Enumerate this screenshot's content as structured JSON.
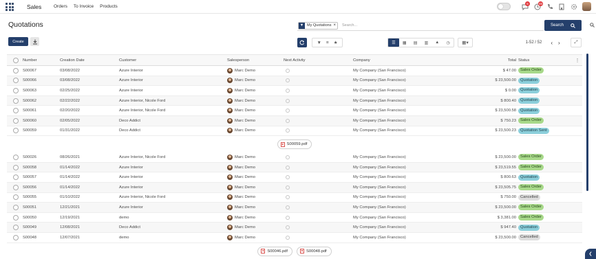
{
  "app": {
    "brand": "Sales",
    "menu": [
      "Orders",
      "To Invoice",
      "Products"
    ],
    "badges": {
      "chat": "6",
      "activity": "46"
    }
  },
  "page": {
    "title": "Quotations",
    "create_label": "Create"
  },
  "search": {
    "facet": "My Quotations",
    "placeholder": "Search...",
    "button_label": "Search"
  },
  "pager": {
    "range": "1-52 / 52"
  },
  "columns": {
    "number": "Number",
    "date": "Creation Date",
    "customer": "Customer",
    "salesperson": "Salesperson",
    "activity": "Next Activity",
    "company": "Company",
    "total": "Total",
    "status": "Status"
  },
  "rows_a": [
    {
      "num": "S00067",
      "date": "03/08/2022",
      "customer": "Azure Interior",
      "sales": "Marc Demo",
      "company": "My Company (San Francisco)",
      "total": "$ 47.00",
      "status": "Sales Order",
      "st": "so"
    },
    {
      "num": "S00066",
      "date": "03/08/2022",
      "customer": "Azure Interior",
      "sales": "Marc Demo",
      "company": "My Company (San Francisco)",
      "total": "$ 23,500.00",
      "status": "Quotation",
      "st": "q"
    },
    {
      "num": "S00063",
      "date": "02/25/2022",
      "customer": "Azure Interior",
      "sales": "Marc Demo",
      "company": "My Company (San Francisco)",
      "total": "$ 0.00",
      "status": "Quotation",
      "st": "q"
    },
    {
      "num": "S00062",
      "date": "02/22/2022",
      "customer": "Azure Interior, Nicole Ford",
      "sales": "Marc Demo",
      "company": "My Company (San Francisco)",
      "total": "$ 800.40",
      "status": "Quotation",
      "st": "q"
    },
    {
      "num": "S00061",
      "date": "02/20/2022",
      "customer": "Azure Interior, Nicole Ford",
      "sales": "Marc Demo",
      "company": "My Company (San Francisco)",
      "total": "$ 23,500.58",
      "status": "Quotation",
      "st": "q"
    },
    {
      "num": "S00060",
      "date": "02/05/2022",
      "customer": "Deco Addict",
      "sales": "Marc Demo",
      "company": "My Company (San Francisco)",
      "total": "$ 750.23",
      "status": "Sales Order",
      "st": "so"
    },
    {
      "num": "S00059",
      "date": "01/31/2022",
      "customer": "Deco Addict",
      "sales": "Marc Demo",
      "company": "My Company (San Francisco)",
      "total": "$ 23,500.23",
      "status": "Quotation Sent",
      "st": "qs"
    }
  ],
  "chips_a": [
    "S00059.pdf"
  ],
  "rows_b": [
    {
      "num": "S00026",
      "date": "08/26/2021",
      "customer": "Azure Interior, Nicole Ford",
      "sales": "Marc Demo",
      "company": "My Company (San Francisco)",
      "total": "$ 23,500.00",
      "status": "Sales Order",
      "st": "so"
    },
    {
      "num": "S00058",
      "date": "01/14/2022",
      "customer": "Azure Interior",
      "sales": "Marc Demo",
      "company": "My Company (San Francisco)",
      "total": "$ 23,519.55",
      "status": "Sales Order",
      "st": "so"
    },
    {
      "num": "S00057",
      "date": "01/14/2022",
      "customer": "Azure Interior",
      "sales": "Marc Demo",
      "company": "My Company (San Francisco)",
      "total": "$ 800.63",
      "status": "Quotation",
      "st": "q"
    },
    {
      "num": "S00056",
      "date": "01/14/2022",
      "customer": "Azure Interior",
      "sales": "Marc Demo",
      "company": "My Company (San Francisco)",
      "total": "$ 23,505.75",
      "status": "Sales Order",
      "st": "so"
    },
    {
      "num": "S00055",
      "date": "01/10/2022",
      "customer": "Azure Interior, Nicole Ford",
      "sales": "Marc Demo",
      "company": "My Company (San Francisco)",
      "total": "$ 750.00",
      "status": "Cancelled",
      "st": "c"
    },
    {
      "num": "S00051",
      "date": "12/21/2021",
      "customer": "Azure Interior",
      "sales": "Marc Demo",
      "company": "My Company (San Francisco)",
      "total": "$ 23,500.00",
      "status": "Sales Order",
      "st": "so"
    },
    {
      "num": "S00050",
      "date": "12/19/2021",
      "customer": "demo",
      "sales": "Marc Demo",
      "company": "My Company (San Francisco)",
      "total": "$ 3,381.00",
      "status": "Sales Order",
      "st": "so"
    },
    {
      "num": "S00049",
      "date": "12/08/2021",
      "customer": "Deco Addict",
      "sales": "Marc Demo",
      "company": "My Company (San Francisco)",
      "total": "$ 947.40",
      "status": "Quotation",
      "st": "q"
    },
    {
      "num": "S00048",
      "date": "12/07/2021",
      "customer": "demo",
      "sales": "Marc Demo",
      "company": "My Company (San Francisco)",
      "total": "$ 23,500.00",
      "status": "Cancelled",
      "st": "c"
    }
  ],
  "chips_b": [
    "S00046.pdf",
    "S00048.pdf"
  ],
  "colors": {
    "primary": "#243f6b",
    "sales_order": "#a8d98a",
    "quotation": "#8ccfdb",
    "cancelled": "#dedede"
  }
}
